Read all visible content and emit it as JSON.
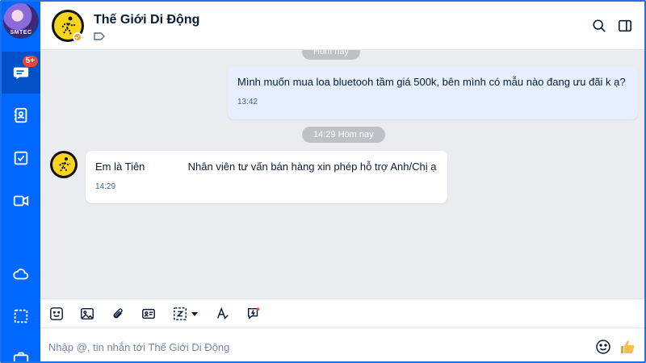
{
  "sidebar": {
    "profile_caption": "SMTEC",
    "messages_badge": "5+",
    "items": [
      {
        "name": "messages",
        "icon": "chat-bubble-icon"
      },
      {
        "name": "contacts",
        "icon": "contact-book-icon"
      },
      {
        "name": "todo",
        "icon": "checkbox-icon"
      },
      {
        "name": "video-call",
        "icon": "video-camera-icon"
      },
      {
        "name": "cloud",
        "icon": "cloud-icon"
      },
      {
        "name": "screenshot",
        "icon": "capture-frame-icon"
      },
      {
        "name": "toolbox",
        "icon": "briefcase-icon"
      }
    ]
  },
  "header": {
    "contact_name": "Thế Giới Di Động"
  },
  "chat": {
    "date_chip_top": "Hôm nay",
    "date_chip_mid": "14:29 Hôm nay",
    "messages": [
      {
        "direction": "outgoing",
        "text": "Mình muốn mua loa bluetooh tầm giá 500k, bên mình có mẫu nào đang ưu đãi k ạ?",
        "time": "13:42"
      },
      {
        "direction": "incoming",
        "text_part1": "Em là Tiên",
        "text_part2": "Nhân viên tư vấn bán hàng xin phép hỗ trợ Anh/Chị ạ",
        "time": "14:29"
      }
    ]
  },
  "toolbar": {
    "tools": [
      "sticker-icon",
      "image-icon",
      "attachment-icon",
      "contact-card-icon",
      "screenshot-icon",
      "text-format-icon",
      "quick-message-icon"
    ]
  },
  "composer": {
    "placeholder": "Nhập @, tin nhắn tới Thế Giới Di Động"
  },
  "colors": {
    "brand": "#0068ff",
    "sidebar_active": "#0050c8",
    "outgoing_bubble": "#e5efff",
    "chat_background": "#ebecf0",
    "badge": "#e9433a"
  }
}
